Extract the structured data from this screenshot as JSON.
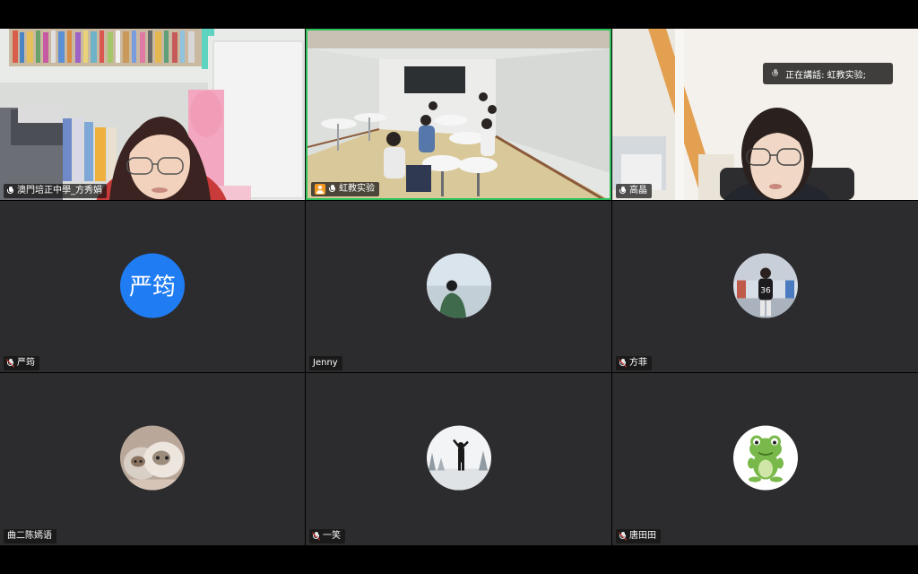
{
  "speaking_label": "正在講話: 虹教实验;",
  "tiles": [
    {
      "name": "澳門培正中學_方秀娟",
      "muted": false
    },
    {
      "name": "虹教实验",
      "muted": false,
      "host": true,
      "active": true
    },
    {
      "name": "高晶",
      "muted": false
    },
    {
      "name": "严筠",
      "muted": true,
      "avatar_text": "严筠"
    },
    {
      "name": "Jenny",
      "muted": false
    },
    {
      "name": "方菲",
      "muted": true
    },
    {
      "name": "曲二陈嫣语",
      "muted": false
    },
    {
      "name": "一笑",
      "muted": true
    },
    {
      "name": "唐田田",
      "muted": true
    }
  ],
  "colors": {
    "background": "#000000",
    "tile": "#2c2c2e",
    "active_border": "#2fbf5a",
    "avatar_blue": "#1f7cf2",
    "host_badge": "#f59b23"
  }
}
